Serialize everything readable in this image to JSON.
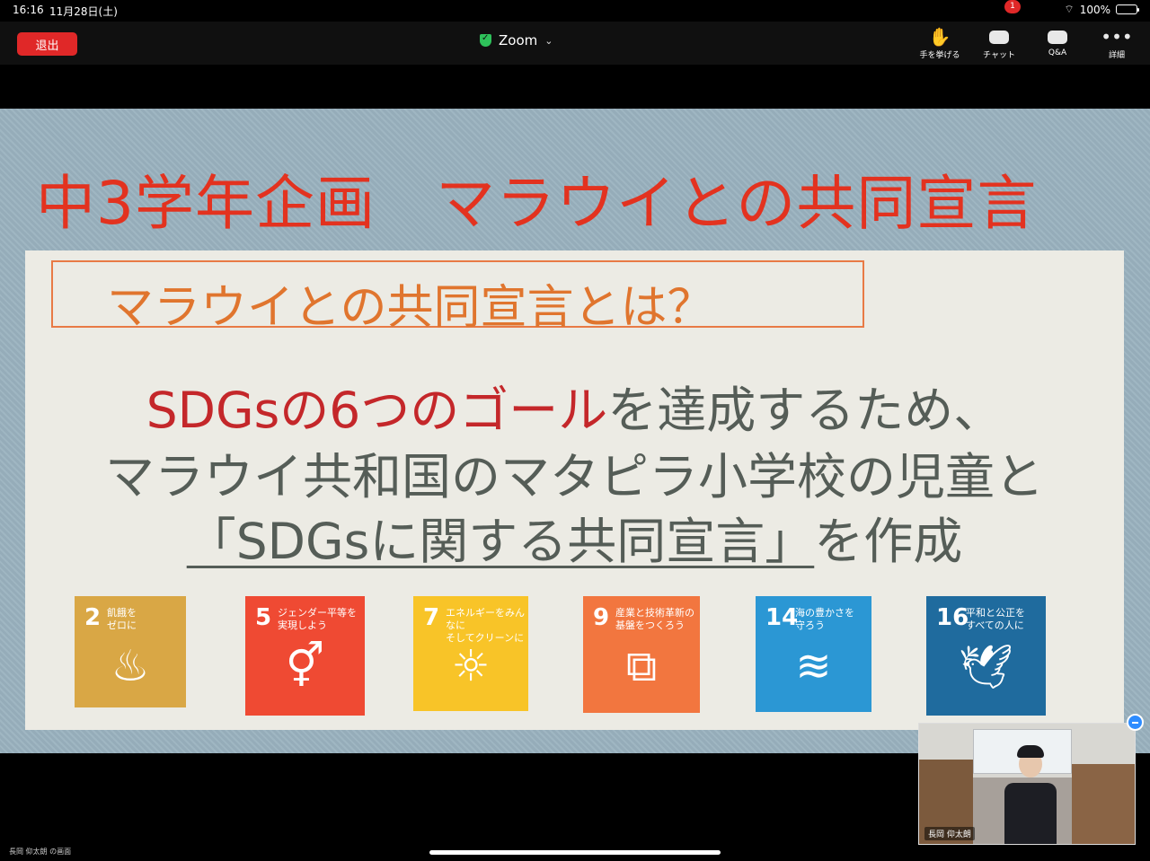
{
  "status": {
    "time": "16:16",
    "date": "11月28日(土)",
    "battery": "100%"
  },
  "toolbar": {
    "leave_label": "退出",
    "meeting_title": "Zoom",
    "items": [
      {
        "label": "手を挙げる",
        "icon": "raise-hand-icon"
      },
      {
        "label": "チャット",
        "icon": "chat-icon",
        "badge": "1"
      },
      {
        "label": "Q&A",
        "icon": "qa-icon"
      },
      {
        "label": "詳細",
        "icon": "more-icon"
      }
    ]
  },
  "slide": {
    "title": "中3学年企画　マラウイとの共同宣言",
    "question": "マラウイとの共同宣言とは？",
    "line1_red": "SDGsの6つのゴール",
    "line1_rest": "を達成するため、",
    "line2": "マラウイ共和国のマタピラ小学校の児童と",
    "line3_underlined": "「SDGsに関する共同宣言」",
    "line3_rest": "を作成",
    "sdgs": [
      {
        "number": "2",
        "label": "飢餓を\nゼロに",
        "color": "#d9a745",
        "icon": "bowl-icon"
      },
      {
        "number": "5",
        "label": "ジェンダー平等を\n実現しよう",
        "color": "#ef4a33",
        "icon": "gender-icon"
      },
      {
        "number": "7",
        "label": "エネルギーをみんなに\nそしてクリーンに",
        "color": "#f8c428",
        "icon": "sun-power-icon"
      },
      {
        "number": "9",
        "label": "産業と技術革新の\n基盤をつくろう",
        "color": "#f2763f",
        "icon": "cubes-icon"
      },
      {
        "number": "14",
        "label": "海の豊かさを\n守ろう",
        "color": "#2b97d4",
        "icon": "fish-icon"
      },
      {
        "number": "16",
        "label": "平和と公正を\nすべての人に",
        "color": "#1f6b9e",
        "icon": "dove-icon"
      }
    ]
  },
  "self_view": {
    "name": "長岡 仰太朗"
  },
  "footer": {
    "screen_owner": "長岡 仰太朗 の画面"
  }
}
